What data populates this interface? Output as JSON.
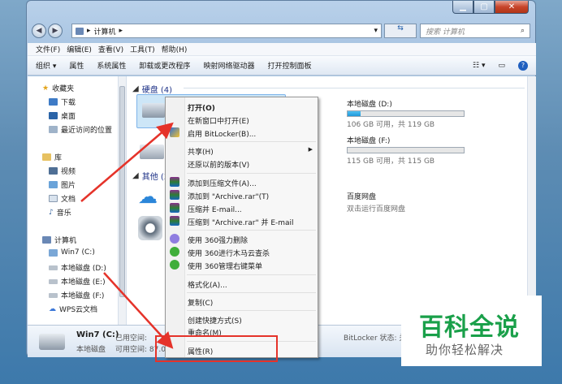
{
  "address": {
    "path": [
      "计算机"
    ],
    "back_glyph": "◀",
    "fwd_glyph": "▶"
  },
  "search": {
    "placeholder": "搜索 计算机"
  },
  "menubar": [
    "文件(F)",
    "编辑(E)",
    "查看(V)",
    "工具(T)",
    "帮助(H)"
  ],
  "toolbar": [
    "组织 ▾",
    "属性",
    "系统属性",
    "卸载或更改程序",
    "映射网络驱动器",
    "打开控制面板"
  ],
  "nav": {
    "favorites": "收藏夹",
    "fav_items": [
      "下载",
      "桌面",
      "最近访问的位置"
    ],
    "library": "库",
    "lib_items": [
      "视频",
      "图片",
      "文档",
      "音乐"
    ],
    "computer": "计算机",
    "comp_items": [
      "Win7 (C:)",
      "本地磁盘 (D:)",
      "本地磁盘 (E:)",
      "本地磁盘 (F:)",
      "WPS云文档"
    ]
  },
  "content": {
    "hdd_header": "硬盘 (4)",
    "other_header": "其他 (3",
    "drive_d": {
      "name": "本地磁盘 (D:)",
      "free": "106 GB 可用，共 119 GB",
      "usage": 0.11
    },
    "drive_f": {
      "name": "本地磁盘 (F:)",
      "free": "115 GB 可用，共 115 GB",
      "usage": 0.0
    },
    "baidu": {
      "name": "百度网盘",
      "sub": "双击运行百度网盘"
    }
  },
  "details": {
    "name": "Win7 (C:)",
    "used_label": "已用空间:",
    "type": "本地磁盘",
    "free_label": "可用空间: 87.0",
    "bitlocker": "BitLocker 状态: 关"
  },
  "context_menu": {
    "open": "打开(O)",
    "open_new": "在新窗口中打开(E)",
    "bitlocker": "启用 BitLocker(B)...",
    "share": "共享(H)",
    "restore": "还原以前的版本(V)",
    "add_archive": "添加到压缩文件(A)...",
    "add_rar": "添加到 \"Archive.rar\"(T)",
    "compress_email": "压缩并 E-mail...",
    "compress_rar_email": "压缩到 \"Archive.rar\" 并 E-mail",
    "del360": "使用 360强力删除",
    "scan360": "使用 360进行木马云查杀",
    "menu360": "使用 360管理右键菜单",
    "format": "格式化(A)...",
    "copy": "复制(C)",
    "shortcut": "创建快捷方式(S)",
    "rename": "重命名(M)",
    "properties": "属性(R)"
  },
  "brand": {
    "title": "百科全说",
    "subtitle": "助你轻松解决"
  },
  "colors": {
    "accent_red": "#e5332a",
    "brand_green": "#1aa04a",
    "header_blue": "#1e3287"
  }
}
